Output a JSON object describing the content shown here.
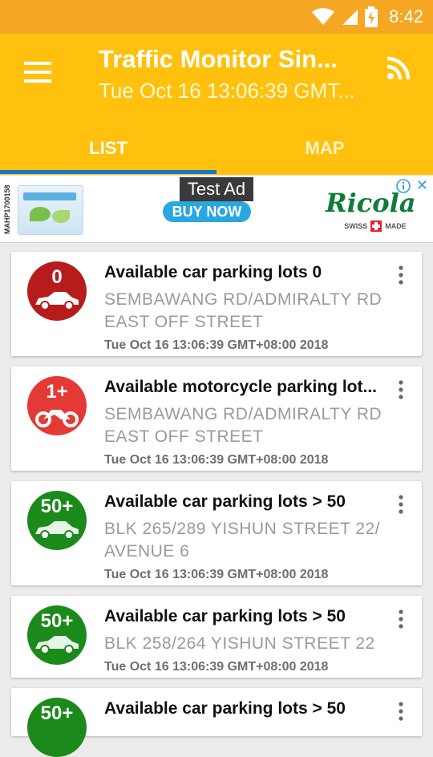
{
  "status_bar": {
    "time": "8:42"
  },
  "app_bar": {
    "title": "Traffic Monitor Sin...",
    "subtitle": "Tue Oct 16 13:06:39 GMT...",
    "tabs": [
      {
        "label": "LIST"
      },
      {
        "label": "MAP"
      }
    ]
  },
  "ad": {
    "code": "MAHP1700158",
    "label": "Test Ad",
    "cta": "BUY NOW",
    "brand": "Ricola",
    "tagline_left": "SWISS",
    "tagline_right": "MADE"
  },
  "colors": {
    "status_bar": "#f5a623",
    "app_bar": "#ffc10e",
    "indicator": "#1e77b8",
    "badge_zero": "#b71c1c",
    "badge_low": "#e53935",
    "badge_high": "#1b8a1b"
  },
  "items": [
    {
      "badge": "0",
      "badge_color": "#b71c1c",
      "vehicle_icon": "car-icon",
      "title": "Available car parking lots 0",
      "address": "SEMBAWANG RD/ADMIRALTY  RD EAST OFF STREET",
      "timestamp": "Tue Oct 16 13:06:39 GMT+08:00 2018"
    },
    {
      "badge": "1+",
      "badge_color": "#e53935",
      "vehicle_icon": "motorcycle-icon",
      "title": "Available motorcycle parking lot...",
      "address": "SEMBAWANG RD/ADMIRALTY  RD EAST OFF STREET",
      "timestamp": "Tue Oct 16 13:06:39 GMT+08:00 2018"
    },
    {
      "badge": "50+",
      "badge_color": "#1b8a1b",
      "vehicle_icon": "car-icon",
      "title": "Available car parking lots > 50",
      "address": "BLK 265/289 YISHUN STREET 22/ AVENUE 6",
      "timestamp": "Tue Oct 16 13:06:39 GMT+08:00 2018"
    },
    {
      "badge": "50+",
      "badge_color": "#1b8a1b",
      "vehicle_icon": "car-icon",
      "title": "Available car parking lots > 50",
      "address": "BLK 258/264 YISHUN STREET 22",
      "timestamp": "Tue Oct 16 13:06:39 GMT+08:00 2018"
    },
    {
      "badge": "50+",
      "badge_color": "#1b8a1b",
      "vehicle_icon": "car-icon",
      "title": "Available car parking lots > 50",
      "address": "",
      "timestamp": ""
    }
  ]
}
